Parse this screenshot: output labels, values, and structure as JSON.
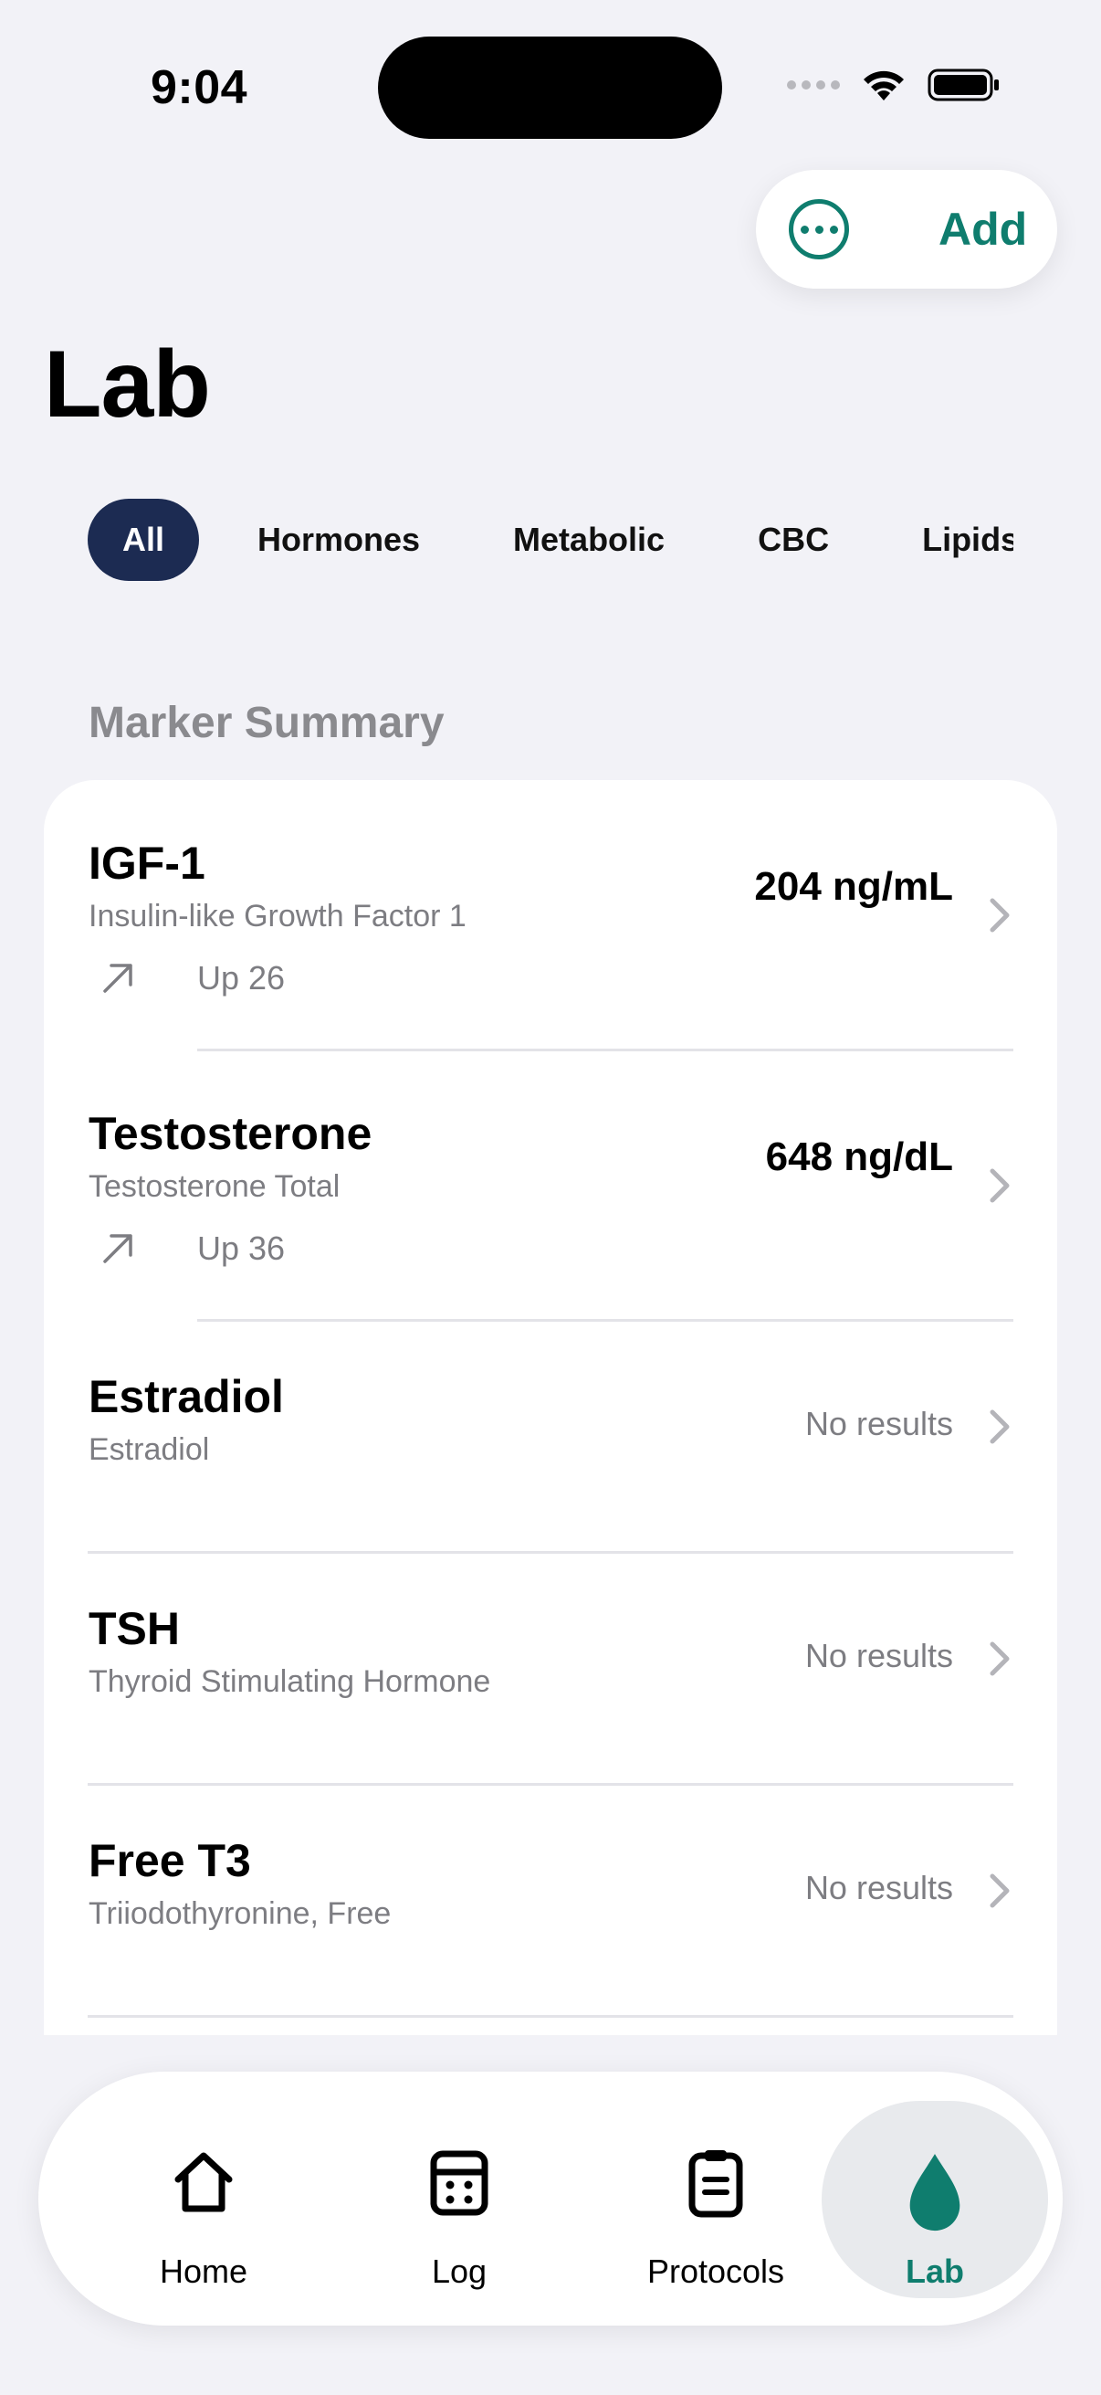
{
  "status_bar": {
    "time": "9:04"
  },
  "toolbar": {
    "add_label": "Add"
  },
  "page": {
    "title": "Lab"
  },
  "filters": {
    "all": "All",
    "hormones": "Hormones",
    "metabolic": "Metabolic",
    "cbc": "CBC",
    "lipids": "Lipids"
  },
  "section": {
    "title": "Marker Summary"
  },
  "markers": [
    {
      "name": "IGF-1",
      "full_name": "Insulin-like Growth Factor 1",
      "value": "204 ng/mL",
      "trend": "Up 26"
    },
    {
      "name": "Testosterone",
      "full_name": "Testosterone Total",
      "value": "648 ng/dL",
      "trend": "Up 36"
    },
    {
      "name": "Estradiol",
      "full_name": "Estradiol",
      "empty": "No results"
    },
    {
      "name": "TSH",
      "full_name": "Thyroid Stimulating Hormone",
      "empty": "No results"
    },
    {
      "name": "Free T3",
      "full_name": "Triiodothyronine, Free",
      "empty": "No results"
    }
  ],
  "tab_bar": {
    "home": "Home",
    "log": "Log",
    "protocols": "Protocols",
    "lab": "Lab"
  },
  "colors": {
    "accent": "#0f7d6e",
    "chip_active": "#1c2b52",
    "background": "#f2f2f7"
  },
  "icons": {
    "more": "ellipsis-circle-icon",
    "trend": "arrow-up-right-icon",
    "chevron": "chevron-right-icon",
    "home": "house-icon",
    "log": "calendar-icon",
    "protocols": "clipboard-icon",
    "lab": "drop-icon"
  }
}
